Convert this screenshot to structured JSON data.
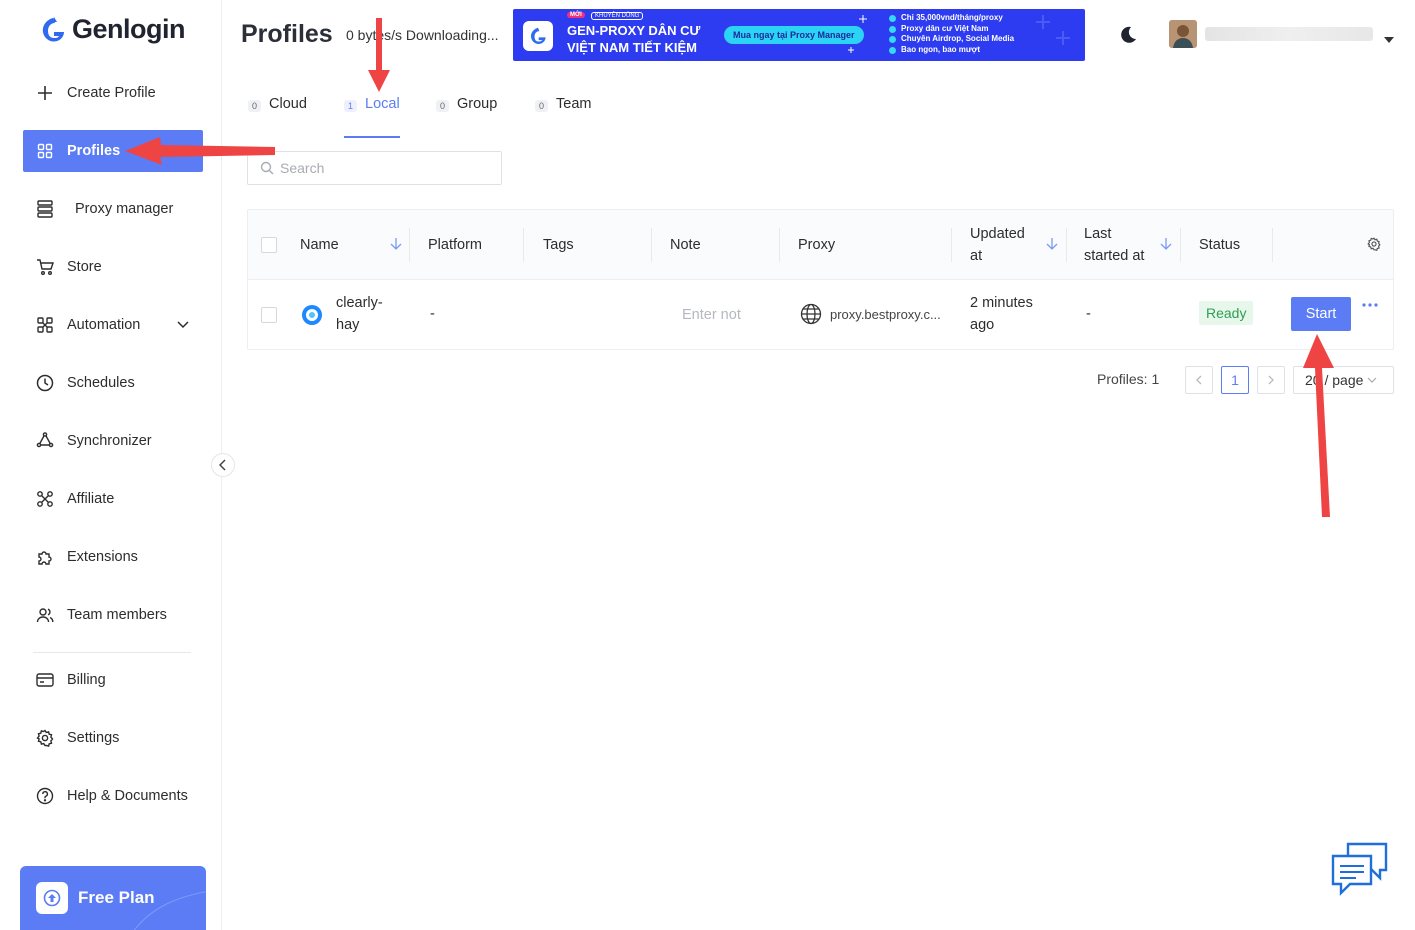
{
  "app": {
    "name": "Genlogin"
  },
  "colors": {
    "accent": "#5b7cf5",
    "ready_green": "#2f9e52",
    "annotation_red": "#ef4444",
    "banner_blue": "#2d3cf0"
  },
  "sidebar": {
    "items": [
      {
        "label": "Create Profile",
        "icon": "plus-icon"
      },
      {
        "label": "Profiles",
        "icon": "grid-icon",
        "active": true
      },
      {
        "label": "Proxy manager",
        "icon": "server-icon"
      },
      {
        "label": "Store",
        "icon": "cart-icon"
      },
      {
        "label": "Automation",
        "icon": "automation-icon",
        "expandable": true
      },
      {
        "label": "Schedules",
        "icon": "clock-icon"
      },
      {
        "label": "Synchronizer",
        "icon": "sync-icon"
      },
      {
        "label": "Affiliate",
        "icon": "affiliate-icon"
      },
      {
        "label": "Extensions",
        "icon": "puzzle-icon"
      },
      {
        "label": "Team members",
        "icon": "team-icon"
      },
      {
        "label": "Billing",
        "icon": "card-icon"
      },
      {
        "label": "Settings",
        "icon": "gear-icon"
      },
      {
        "label": "Help & Documents",
        "icon": "help-icon"
      }
    ],
    "plan": {
      "label": "Free Plan"
    }
  },
  "header": {
    "title": "Profiles",
    "download_status": "0 bytes/s Downloading...",
    "banner": {
      "new_badge": "MỚI",
      "recommend_badge": "KHUYÊN DÙNG",
      "headline_1": "GEN-PROXY DÂN CƯ",
      "headline_2": "VIỆT NAM TIẾT KIỆM",
      "cta": "Mua ngay tại Proxy Manager",
      "bullets": [
        "Chỉ 35,000vnd/tháng/proxy",
        "Proxy dân cư Việt Nam",
        "Chuyên Airdrop, Social Media",
        "Bao ngon, bao mượt"
      ]
    }
  },
  "tabs": [
    {
      "label": "Cloud",
      "count": "0"
    },
    {
      "label": "Local",
      "count": "1",
      "active": true
    },
    {
      "label": "Group",
      "count": "0"
    },
    {
      "label": "Team",
      "count": "0"
    }
  ],
  "search": {
    "placeholder": "Search",
    "value": ""
  },
  "table": {
    "columns": {
      "name": "Name",
      "platform": "Platform",
      "tags": "Tags",
      "note": "Note",
      "proxy": "Proxy",
      "updated_1": "Updated",
      "updated_2": "at",
      "last_started_1": "Last",
      "last_started_2": "started at",
      "status": "Status"
    },
    "rows": [
      {
        "name_1": "clearly-",
        "name_2": "hay",
        "platform": "-",
        "tags": "",
        "note_placeholder": "Enter not",
        "proxy": "proxy.bestproxy.c...",
        "updated_1": "2 minutes",
        "updated_2": "ago",
        "last_started": "-",
        "status": "Ready",
        "action": "Start"
      }
    ]
  },
  "pagination": {
    "total": "Profiles: 1",
    "current_page": "1",
    "page_size": "20 / page"
  }
}
